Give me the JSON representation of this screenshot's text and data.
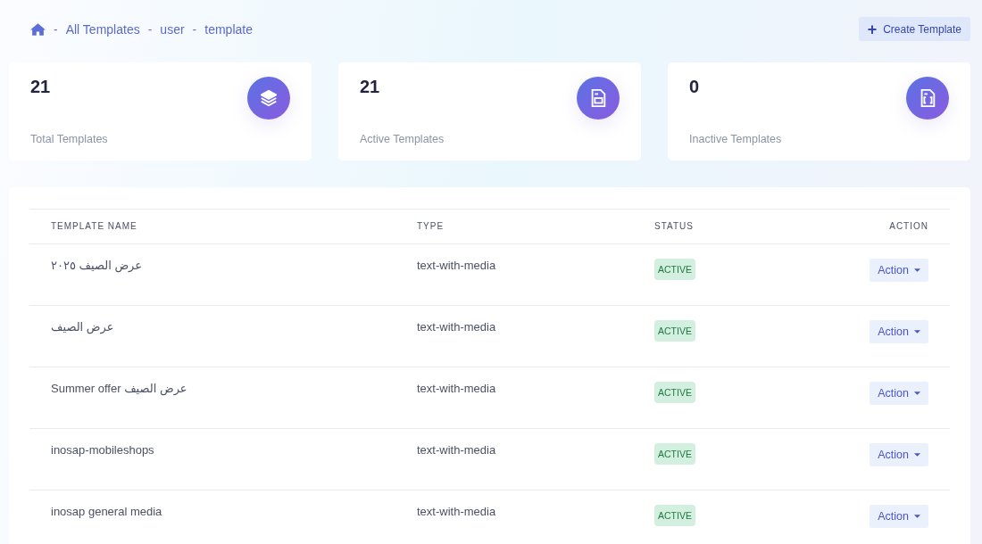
{
  "breadcrumb": {
    "separator": "-",
    "items": [
      "All Templates",
      "user",
      "template"
    ]
  },
  "create_button": {
    "icon": "+",
    "label": "Create Template"
  },
  "stats": [
    {
      "value": "21",
      "label": "Total Templates",
      "kind": "layers"
    },
    {
      "value": "21",
      "label": "Active Templates",
      "kind": "file"
    },
    {
      "value": "0",
      "label": "Inactive Templates",
      "kind": "file-code"
    }
  ],
  "table": {
    "columns": [
      "TEMPLATE NAME",
      "TYPE",
      "STATUS",
      "ACTION"
    ],
    "rows": [
      {
        "name": "عرض الصيف ٢٠٢٥",
        "type": "text-with-media",
        "status": {
          "label": "ACTIVE",
          "kind": "active"
        },
        "action": "Action"
      },
      {
        "name": "عرض الصيف",
        "type": "text-with-media",
        "status": {
          "label": "ACTIVE",
          "kind": "active"
        },
        "action": "Action"
      },
      {
        "name": "Summer offer عرض الصيف",
        "type": "text-with-media",
        "status": {
          "label": "ACTIVE",
          "kind": "active"
        },
        "action": "Action"
      },
      {
        "name": "inosap-mobileshops",
        "type": "text-with-media",
        "status": {
          "label": "ACTIVE",
          "kind": "active"
        },
        "action": "Action"
      },
      {
        "name": "inosap general media",
        "type": "text-with-media",
        "status": {
          "label": "ACTIVE",
          "kind": "active"
        },
        "action": "Action"
      }
    ]
  }
}
